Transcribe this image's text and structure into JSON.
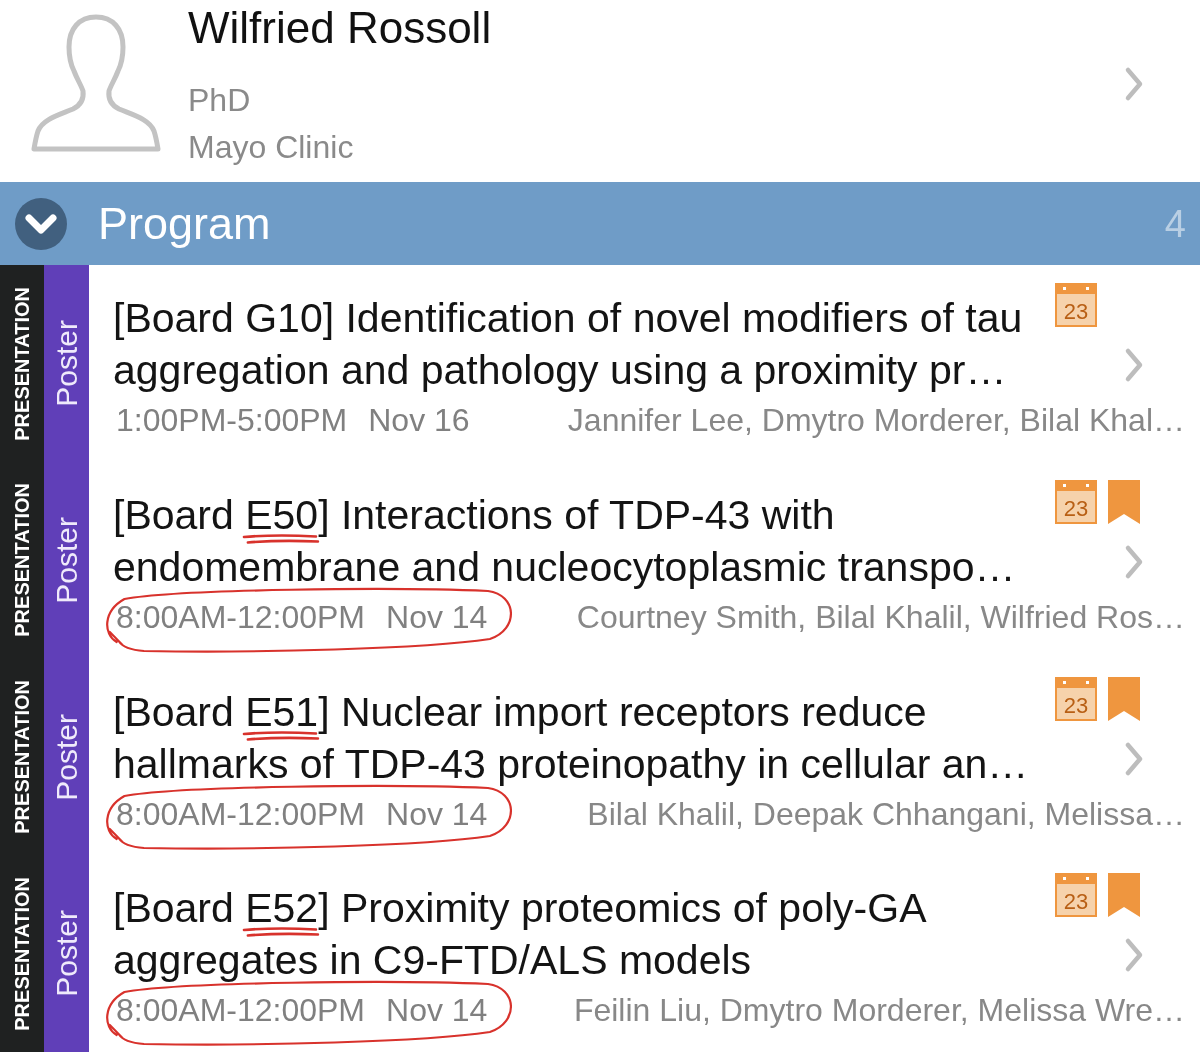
{
  "profile": {
    "name": "Wilfried Rossoll",
    "degree": "PhD",
    "affiliation": "Mayo Clinic"
  },
  "section": {
    "title": "Program",
    "count": "4",
    "expanded": true
  },
  "items": [
    {
      "category": "PRESENTATION",
      "type": "Poster",
      "title": "[Board G10] Identification of novel modifiers of tau aggregation and pathology using a proximity pr…",
      "time": "1:00PM-5:00PM",
      "date": "Nov 16",
      "authors": "Jannifer Lee, Dmytro Morderer, Bilal Khal…",
      "calendar_day": "23",
      "bookmarked": false,
      "board_underlined": false,
      "time_circled": false
    },
    {
      "category": "PRESENTATION",
      "type": "Poster",
      "title": "[Board E50] Interactions of TDP-43 with endomembrane and nucleocytoplasmic transpo…",
      "time": "8:00AM-12:00PM",
      "date": "Nov 14",
      "authors": "Courtney Smith, Bilal Khalil, Wilfried Ros…",
      "calendar_day": "23",
      "bookmarked": true,
      "board_underlined": true,
      "time_circled": true
    },
    {
      "category": "PRESENTATION",
      "type": "Poster",
      "title": "[Board E51] Nuclear import receptors reduce hallmarks of TDP-43 proteinopathy in cellular an…",
      "time": "8:00AM-12:00PM",
      "date": "Nov 14",
      "authors": "Bilal Khalil, Deepak Chhangani, Melissa…",
      "calendar_day": "23",
      "bookmarked": true,
      "board_underlined": true,
      "time_circled": true
    },
    {
      "category": "PRESENTATION",
      "type": "Poster",
      "title": "[Board E52] Proximity proteomics of poly-GA aggregates in C9-FTD/ALS models",
      "time": "8:00AM-12:00PM",
      "date": "Nov 14",
      "authors": "Feilin Liu, Dmytro Morderer, Melissa Wre…",
      "calendar_day": "23",
      "bookmarked": true,
      "board_underlined": true,
      "time_circled": true
    }
  ]
}
